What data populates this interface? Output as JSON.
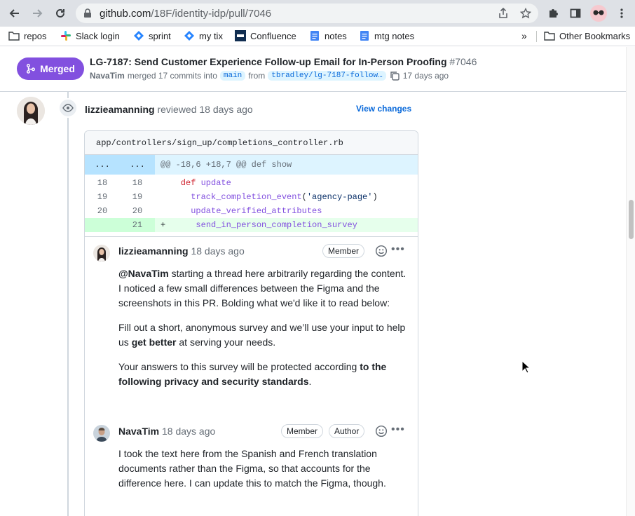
{
  "browser": {
    "url_host": "github.com",
    "url_path": "/18F/identity-idp/pull/7046",
    "bookmarks": [
      "repos",
      "Slack login",
      "sprint",
      "my tix",
      "Confluence",
      "notes",
      "mtg notes"
    ],
    "overflow_label": "»",
    "other_bookmarks": "Other Bookmarks"
  },
  "pr": {
    "state_label": "Merged",
    "title": "LG-7187: Send Customer Experience Follow-up Email for In-Person Proofing",
    "number": "#7046",
    "merger": "NavaTim",
    "merged_text": "merged 17 commits into",
    "base_branch": "main",
    "from_text": "from",
    "head_branch": "tbradley/lg-7187-follow…",
    "age": "17 days ago"
  },
  "review": {
    "reviewer": "lizzieamanning",
    "action": "reviewed",
    "age": "18 days ago",
    "view_changes": "View changes",
    "file_path": "app/controllers/sign_up/completions_controller.rb",
    "hunk_left": "...",
    "hunk_right": "...",
    "hunk_header": "@@ -18,6 +18,7 @@ def show",
    "lines": [
      {
        "old": "18",
        "new": "18",
        "sign": "",
        "code": "    def update",
        "type": "ctx"
      },
      {
        "old": "19",
        "new": "19",
        "sign": "",
        "code": "      track_completion_event('agency-page')",
        "type": "ctx"
      },
      {
        "old": "20",
        "new": "20",
        "sign": "",
        "code": "      update_verified_attributes",
        "type": "ctx"
      },
      {
        "old": "",
        "new": "21",
        "sign": "+",
        "code": "      send_in_person_completion_survey",
        "type": "add"
      }
    ]
  },
  "comments": [
    {
      "author": "lizzieamanning",
      "age": "18 days ago",
      "badges": [
        "Member"
      ],
      "mention": "@NavaTim",
      "p1_rest": " starting a thread here arbitrarily regarding the content. I noticed a few small differences between the Figma and the screenshots in this PR. Bolding what we'd like it to read below:",
      "p2_a": "Fill out a short, anonymous survey and we’ll use your input to help us ",
      "p2_bold": "get better",
      "p2_b": " at serving your needs.",
      "p3_a": "Your answers to this survey will be protected according ",
      "p3_bold": "to the following privacy and security standards",
      "p3_b": "."
    },
    {
      "author": "NavaTim",
      "age": "18 days ago",
      "badges": [
        "Member",
        "Author"
      ],
      "text": "I took the text here from the Spanish and French translation documents rather than the Figma, so that accounts for the difference here. I can update this to match the Figma, though."
    }
  ],
  "colors": {
    "merged": "#8250df",
    "link": "#0969da",
    "diff_add": "#e6ffec",
    "hunk": "#ddf4ff"
  }
}
